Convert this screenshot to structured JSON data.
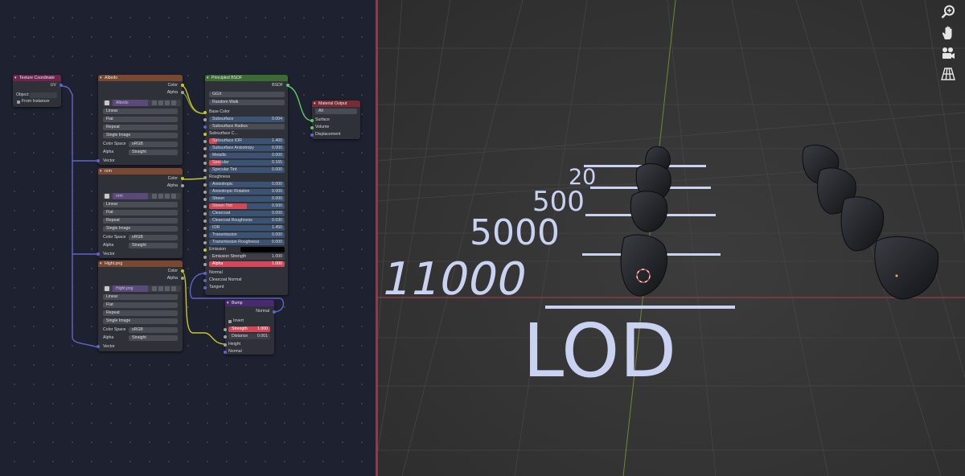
{
  "colors": {
    "editor_bg": "#1e2130",
    "viewport_bg": "#333333",
    "divider": "#8c3a4e",
    "text3d": "#c9d2f0",
    "link_yellow": "#c7c729",
    "link_purple": "#6363c7",
    "link_green": "#63c763",
    "slider_fill": "#d2485a"
  },
  "tex_coord": {
    "title": "Texture Coordinate",
    "out_uv": "UV",
    "object_label": "Object:",
    "from_instancer": "From Instancer"
  },
  "albedo": {
    "title": "Albedo",
    "out_color": "Color",
    "out_alpha": "Alpha",
    "image_name": "Albedo",
    "interp": "Linear",
    "proj": "Flat",
    "ext": "Repeat",
    "source": "Single Image",
    "cs_label": "Color Space",
    "cs_value": "sRGB",
    "alpha_label": "Alpha",
    "alpha_value": "Straight",
    "in_vector": "Vector"
  },
  "nrm": {
    "title": "nrm",
    "out_color": "Color",
    "out_alpha": "Alpha",
    "image_name": "nrm",
    "interp": "Linear",
    "proj": "Flat",
    "ext": "Repeat",
    "source": "Single Image",
    "cs_label": "Color Space",
    "cs_value": "sRGB",
    "alpha_label": "Alpha",
    "alpha_value": "Straight",
    "in_vector": "Vector"
  },
  "hight": {
    "title": "Hight.png",
    "out_color": "Color",
    "out_alpha": "Alpha",
    "image_name": "Hight.png",
    "interp": "Linear",
    "proj": "Flat",
    "ext": "Repeat",
    "source": "Single Image",
    "cs_label": "Color Space",
    "cs_value": "sRGB",
    "alpha_label": "Alpha",
    "alpha_value": "Straight",
    "in_vector": "Vector"
  },
  "bsdf": {
    "title": "Principled BSDF",
    "out": "BSDF",
    "dist": "GGX",
    "sss_method": "Random Walk",
    "base_color": "Base Color",
    "subsurface": {
      "label": "Subsurface",
      "value": "0.004"
    },
    "subsurface_radius": "Subsurface Radius",
    "subsurface_color": "Subsurface C...",
    "subsurface_ior": {
      "label": "Subsurface IOR",
      "value": "1.400"
    },
    "subsurface_aniso": {
      "label": "Subsurface Anisotropy",
      "value": "0.000"
    },
    "metallic": {
      "label": "Metallic",
      "value": "0.000"
    },
    "specular": {
      "label": "Specular",
      "value": "0.165"
    },
    "specular_tint": {
      "label": "Specular Tint",
      "value": "0.000"
    },
    "roughness": "Roughness",
    "anisotropic": {
      "label": "Anisotropic",
      "value": "0.000"
    },
    "aniso_rotation": {
      "label": "Anisotropic Rotation",
      "value": "0.000"
    },
    "sheen": {
      "label": "Sheen",
      "value": "0.000"
    },
    "sheen_tint": {
      "label": "Sheen Tint",
      "value": "0.500"
    },
    "clearcoat": {
      "label": "Clearcoat",
      "value": "0.000"
    },
    "clearcoat_roughness": {
      "label": "Clearcoat Roughness",
      "value": "0.030"
    },
    "ior": {
      "label": "IOR",
      "value": "1.450"
    },
    "transmission": {
      "label": "Transmission",
      "value": "0.000"
    },
    "transmission_roughness": {
      "label": "Transmission Roughness",
      "value": "0.000"
    },
    "emission": "Emission",
    "emission_strength": {
      "label": "Emission Strength",
      "value": "1.000"
    },
    "alpha": {
      "label": "Alpha",
      "value": "1.000"
    },
    "normal": "Normal",
    "clearcoat_normal": "Clearcoat Normal",
    "tangent": "Tangent"
  },
  "material_output": {
    "title": "Material Output",
    "target": "All",
    "surface": "Surface",
    "volume": "Volume",
    "displacement": "Displacement"
  },
  "bump": {
    "title": "Bump",
    "out_normal": "Normal",
    "invert": "Invert",
    "strength": {
      "label": "Strength",
      "value": "1.000"
    },
    "distance": {
      "label": "Distance",
      "value": "0.001"
    },
    "height": "Height",
    "normal": "Normal"
  },
  "viewport": {
    "lod_label": "LOD",
    "lod_values": [
      "20",
      "500",
      "5000",
      "11000"
    ]
  },
  "nav_icons": [
    "zoom-icon",
    "hand-pan-icon",
    "camera-icon",
    "grid-perspective-icon"
  ]
}
